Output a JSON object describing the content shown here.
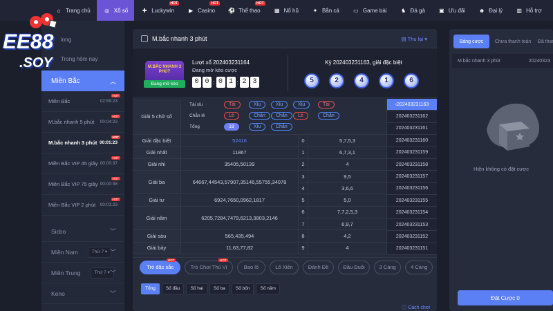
{
  "topnav": {
    "items": [
      {
        "label": "Trang chủ",
        "icon": "home-icon",
        "hot": false,
        "active": false
      },
      {
        "label": "Xổ số",
        "icon": "lottery-icon",
        "hot": false,
        "active": true
      },
      {
        "label": "Luckywin",
        "icon": "gamepad-icon",
        "hot": true,
        "active": false
      },
      {
        "label": "Casino",
        "icon": "play-icon",
        "hot": true,
        "active": false
      },
      {
        "label": "Thể thao",
        "icon": "ball-icon",
        "hot": true,
        "active": false
      },
      {
        "label": "Nổ hũ",
        "icon": "slot-icon",
        "hot": false,
        "active": false
      },
      {
        "label": "Bắn cá",
        "icon": "fish-icon",
        "hot": false,
        "active": false
      },
      {
        "label": "Game bài",
        "icon": "cards-icon",
        "hot": false,
        "active": false
      },
      {
        "label": "Đá gà",
        "icon": "rooster-icon",
        "hot": false,
        "active": false
      },
      {
        "label": "Ưu đãi",
        "icon": "gift-icon",
        "hot": false,
        "active": false
      },
      {
        "label": "Đại lý",
        "icon": "agent-icon",
        "hot": false,
        "active": false
      },
      {
        "label": "Hỗ trợ",
        "icon": "support-icon",
        "hot": false,
        "active": false
      }
    ],
    "hot_label": "HOT"
  },
  "logo": {
    "brand": "EE88",
    "sub": ".SOY"
  },
  "sidebar": {
    "top_items": [
      "long",
      "Trong hôm nay"
    ],
    "section": "Miền Bắc",
    "games": [
      {
        "name": "Miền Bắc",
        "time": "02:59:23",
        "hot": true,
        "selected": false
      },
      {
        "name": "M.bắc nhanh 5 phút",
        "time": "00:04:23",
        "hot": true,
        "selected": false
      },
      {
        "name": "M.bắc nhanh 3 phút",
        "time": "00:01:23",
        "hot": true,
        "selected": true
      },
      {
        "name": "Miền Bắc VIP 45 giây",
        "time": "00:00:37",
        "hot": true,
        "selected": false
      },
      {
        "name": "Miền Bắc VIP 75 giây",
        "time": "00:00:38",
        "hot": true,
        "selected": false
      },
      {
        "name": "Miền Bắc VIP 2 phút",
        "time": "00:01:23",
        "hot": true,
        "selected": false
      }
    ],
    "categories": [
      {
        "name": "Sicbo",
        "sub": ""
      },
      {
        "name": "Miền Nam",
        "sub": "Thứ 7 ▾"
      },
      {
        "name": "Miền Trung",
        "sub": "Thứ 7 ▾"
      },
      {
        "name": "Keno",
        "sub": ""
      }
    ]
  },
  "main": {
    "title": "M.bắc nhanh 3 phút",
    "collapse": "Thu lại",
    "game_logo_text": "M.BẮC NHANH 3 PHÚT",
    "status": "Đang mở kèo",
    "round_line": "Lượt xổ 202403231164",
    "round_sub": "Đang mở kèo cược",
    "countdown": [
      "0",
      "0",
      "0",
      "1",
      "2",
      "3"
    ],
    "last_line": "Kỳ 202403231163, giải đặc biệt",
    "balls": [
      "5",
      "2",
      "4",
      "1",
      "6"
    ]
  },
  "stats": {
    "label": "Giải 5 chữ số",
    "rows": [
      {
        "label": "Tài xỉu",
        "chips": [
          {
            "t": "Tài",
            "c": "red"
          },
          {
            "t": "Xỉu",
            "c": "blue"
          },
          {
            "t": "Xỉu",
            "c": "blue"
          },
          {
            "t": "Xỉu",
            "c": "blue"
          },
          {
            "t": "Tài",
            "c": "red"
          }
        ]
      },
      {
        "label": "Chẵn lẻ",
        "chips": [
          {
            "t": "Lẻ",
            "c": "red"
          },
          {
            "t": "Chẵn",
            "c": "blue"
          },
          {
            "t": "Chẵn",
            "c": "blue"
          },
          {
            "t": "Lẻ",
            "c": "red"
          },
          {
            "t": "Chẵn",
            "c": "blue"
          }
        ]
      },
      {
        "label": "Tổng",
        "chips": [
          {
            "t": "18",
            "c": "fill"
          },
          {
            "t": "Xỉu",
            "c": "blue"
          },
          {
            "t": "Chẵn",
            "c": "blue"
          }
        ]
      }
    ]
  },
  "results": [
    {
      "label": "Giải đặc biệt",
      "value": "52416",
      "highlight": true
    },
    {
      "label": "Giải nhất",
      "value": "11867"
    },
    {
      "label": "Giải nhì",
      "value": "35405,50139"
    },
    {
      "label": "Giải ba",
      "value": "64667,44543,57907,35146,55755,34078"
    },
    {
      "label": "Giải tư",
      "value": "6924,7650,0962,1817"
    },
    {
      "label": "Giải năm",
      "value": "6205,7284,7479,6213,3803,2146"
    },
    {
      "label": "Giải sáu",
      "value": "565,435,494"
    },
    {
      "label": "Giải bảy",
      "value": "11,63,77,82"
    }
  ],
  "tails": [
    {
      "n": "0",
      "v": "5,7,5,3"
    },
    {
      "n": "1",
      "v": "6,7,3,1"
    },
    {
      "n": "2",
      "v": "4"
    },
    {
      "n": "3",
      "v": "9,5"
    },
    {
      "n": "4",
      "v": "3,6,6"
    },
    {
      "n": "5",
      "v": "5,0"
    },
    {
      "n": "6",
      "v": "7,7,2,5,3"
    },
    {
      "n": "7",
      "v": "6,9,7"
    },
    {
      "n": "8",
      "v": "4,2"
    },
    {
      "n": "9",
      "v": "4"
    }
  ],
  "round_ids": [
    "202403231163",
    "202403231162",
    "202403231161",
    "202403231160",
    "202403231159",
    "202403231158",
    "202403231157",
    "202403231156",
    "202403231155",
    "202403231154",
    "202403231153",
    "202403231152",
    "202403231151"
  ],
  "bet_tabs": [
    {
      "label": "Trò đặc sắc",
      "active": true,
      "hot": true
    },
    {
      "label": "Trò Chơi Thú Vị",
      "active": false,
      "hot": true
    },
    {
      "label": "Bao lô",
      "active": false,
      "hot": false
    },
    {
      "label": "Lô Xiên",
      "active": false,
      "hot": false
    },
    {
      "label": "Đánh Đề",
      "active": false,
      "hot": false
    },
    {
      "label": "Đầu Đuôi",
      "active": false,
      "hot": false
    },
    {
      "label": "3 Càng",
      "active": false,
      "hot": false
    },
    {
      "label": "4 Càng",
      "active": false,
      "hot": false
    }
  ],
  "sub_tabs": [
    {
      "label": "Tổng",
      "active": true
    },
    {
      "label": "Số đầu",
      "active": false
    },
    {
      "label": "Số hai",
      "active": false
    },
    {
      "label": "Số ba",
      "active": false
    },
    {
      "label": "Số bốn",
      "active": false
    },
    {
      "label": "Số năm",
      "active": false
    }
  ],
  "howto": "Cách chơi",
  "right": {
    "tabs": [
      {
        "label": "Bảng cược",
        "active": true
      },
      {
        "label": "Chưa thanh toán",
        "active": false
      },
      {
        "label": "Đã thanh",
        "active": false
      }
    ],
    "row_name": "M.bắc nhanh 3 phút",
    "row_id": "20240323",
    "empty": "Hiện không có đặt cược",
    "button": "Đặt Cược 0"
  },
  "colors": {
    "accent": "#5b7ff4",
    "nav_active": "#6b54d6",
    "hot": "#e33333",
    "red_chip": "#e64b4b",
    "blue_chip": "#4a86ff",
    "status_green": "#1fae5c"
  }
}
